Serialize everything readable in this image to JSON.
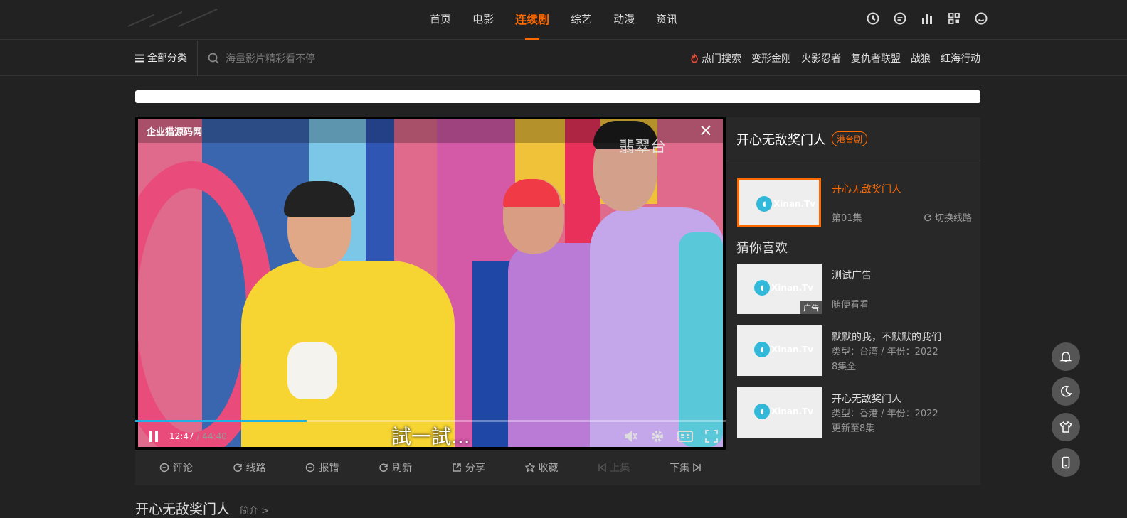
{
  "nav": {
    "items": [
      {
        "label": "首页"
      },
      {
        "label": "电影"
      },
      {
        "label": "连续剧"
      },
      {
        "label": "综艺"
      },
      {
        "label": "动漫"
      },
      {
        "label": "资讯"
      }
    ],
    "active_index": 2,
    "icons": [
      "clock-icon",
      "message-icon",
      "ranking-icon",
      "grid-icon",
      "user-icon"
    ]
  },
  "subnav": {
    "all_categories": "全部分类",
    "search_placeholder": "海量影片精彩看不停",
    "hot_label": "热门搜索",
    "hot_items": [
      "变形金刚",
      "火影忍者",
      "复仇者联盟",
      "战狼",
      "红海行动"
    ]
  },
  "player": {
    "title": "企业猫源码网",
    "channel_logo": "翡翠台",
    "subtitle": "試一試...",
    "current_time": "12:47",
    "separator": " / ",
    "duration": "44:40",
    "progress_fraction": 0.29
  },
  "toolbar": [
    {
      "label": "评论",
      "icon": "comment-icon"
    },
    {
      "label": "线路",
      "icon": "route-icon"
    },
    {
      "label": "报错",
      "icon": "report-icon"
    },
    {
      "label": "刷新",
      "icon": "refresh-icon"
    },
    {
      "label": "分享",
      "icon": "share-icon"
    },
    {
      "label": "收藏",
      "icon": "star-icon"
    },
    {
      "label": "上集",
      "icon": "prev-icon",
      "disabled": true
    },
    {
      "label": "下集",
      "icon": "next-icon"
    }
  ],
  "sidebar": {
    "title": "开心无敌奖门人",
    "tag": "港台剧",
    "current": {
      "title": "开心无敌奖门人",
      "episode": "第01集",
      "switch": "切换线路"
    },
    "guess_heading": "猜你喜欢",
    "recommendations": [
      {
        "title": "测试广告",
        "line2": "",
        "line3": "随便看看",
        "ad": "广告"
      },
      {
        "title": "默默的我，不默默的我们",
        "line2": "类型：台湾 / 年份：2022",
        "line3": "8集全"
      },
      {
        "title": "开心无敌奖门人",
        "line2": "类型：香港 / 年份：2022",
        "line3": "更新至8集"
      }
    ],
    "thumb_watermark": "Xinan.Tv"
  },
  "below": {
    "title": "开心无敌奖门人",
    "intro": "简介 >"
  },
  "floating": [
    "bell-icon",
    "moon-icon",
    "shirt-icon",
    "phone-icon"
  ],
  "colors": {
    "accent": "#ff6a00",
    "progress": "#1fb0e6",
    "background": "#222222"
  }
}
